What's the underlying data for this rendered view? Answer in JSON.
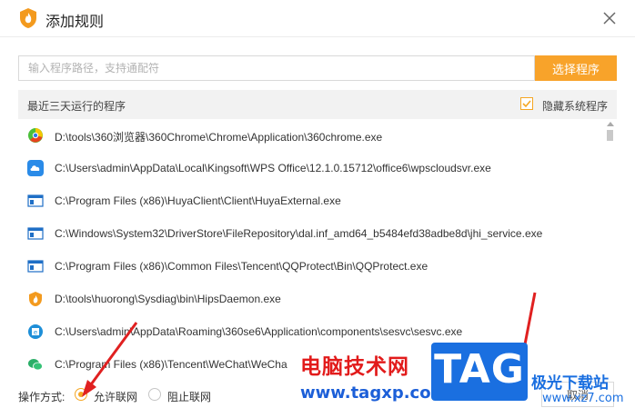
{
  "dialog": {
    "title": "添加规则",
    "path_input_placeholder": "输入程序路径，支持通配符",
    "select_program_label": "选择程序"
  },
  "list_header": {
    "label": "最近三天运行的程序",
    "hide_system_label": "隐藏系统程序",
    "hide_system_checked": true
  },
  "programs": [
    {
      "icon": "360-browser-icon",
      "path": "D:\\tools\\360浏览器\\360Chrome\\Chrome\\Application\\360chrome.exe"
    },
    {
      "icon": "wps-cloud-icon",
      "path": "C:\\Users\\admin\\AppData\\Local\\Kingsoft\\WPS Office\\12.1.0.15712\\office6\\wpscloudsvr.exe"
    },
    {
      "icon": "program-window-icon",
      "path": "C:\\Program Files (x86)\\HuyaClient\\Client\\HuyaExternal.exe"
    },
    {
      "icon": "program-window-icon",
      "path": "C:\\Windows\\System32\\DriverStore\\FileRepository\\dal.inf_amd64_b5484efd38adbe8d\\jhi_service.exe"
    },
    {
      "icon": "program-window-icon",
      "path": "C:\\Program Files (x86)\\Common Files\\Tencent\\QQProtect\\Bin\\QQProtect.exe"
    },
    {
      "icon": "huorong-icon",
      "path": "D:\\tools\\huorong\\Sysdiag\\bin\\HipsDaemon.exe"
    },
    {
      "icon": "360se-icon",
      "path": "C:\\Users\\admin\\AppData\\Roaming\\360se6\\Application\\components\\sesvc\\sesvc.exe"
    },
    {
      "icon": "wechat-icon",
      "path": "C:\\Program Files (x86)\\Tencent\\WeChat\\WeCha"
    }
  ],
  "footer": {
    "mode_label": "操作方式:",
    "allow_label": "允许联网",
    "block_label": "阻止联网",
    "selected": "allow",
    "cancel_label": "取消"
  },
  "watermark": {
    "site_name": "电脑技术网",
    "site_url": "www.tagxp.com",
    "logo_text": "TAG",
    "brand": "极光下载站",
    "brand_url": "www.xz7.com"
  },
  "colors": {
    "accent": "#f8a32a",
    "annotation_arrow": "#e02020"
  }
}
